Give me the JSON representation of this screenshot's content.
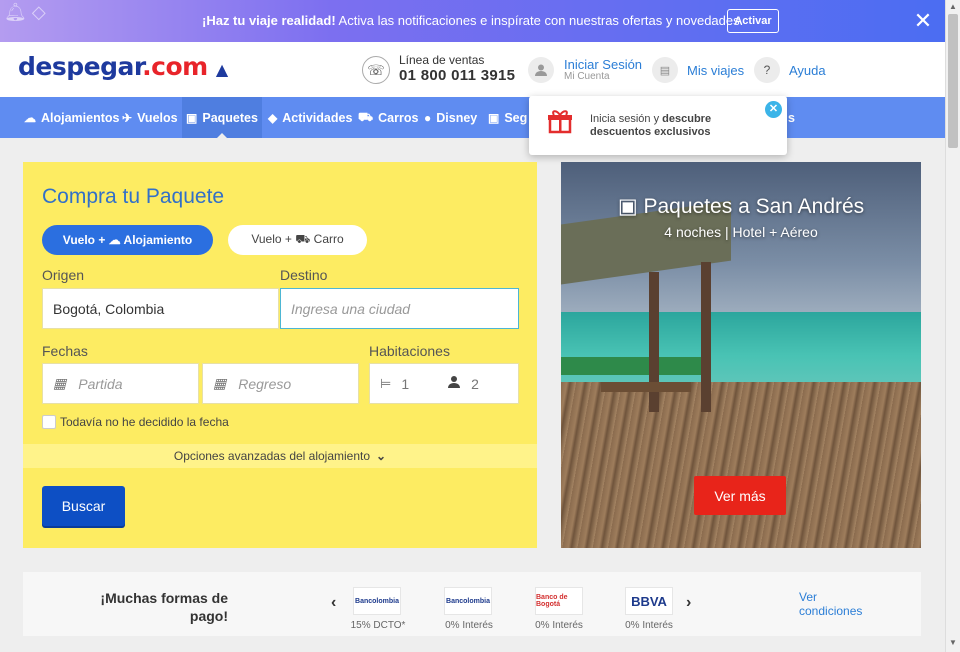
{
  "notification": {
    "bold": "¡Haz tu viaje realidad!",
    "text": " Activa las notificaciones e inspírate con nuestras ofertas y novedades.",
    "button": "Activar",
    "close": "✕"
  },
  "header": {
    "logo": "despegar",
    "logo_dot": ".com",
    "sales_label": "Línea de ventas",
    "sales_phone": "01 800 011 3915",
    "login": "Iniciar Sesión",
    "login_sub": "Mi Cuenta",
    "trips": "Mis viajes",
    "help": "Ayuda",
    "help_icon": "?"
  },
  "nav": {
    "items": [
      {
        "label": "Alojamientos",
        "icon": "☁"
      },
      {
        "label": "Vuelos",
        "icon": "✈"
      },
      {
        "label": "Paquetes",
        "icon": "▣"
      },
      {
        "label": "Actividades",
        "icon": "◆"
      },
      {
        "label": "Carros",
        "icon": "⛟"
      },
      {
        "label": "Disney",
        "icon": "●"
      },
      {
        "label": "Seg",
        "icon": "▣"
      },
      {
        "label": "s",
        "icon": ""
      }
    ]
  },
  "popup": {
    "text1": "Inicia sesión y ",
    "bold1": "descubre",
    "bold2": "descuentos exclusivos",
    "close": "✕"
  },
  "form": {
    "title": "Compra tu Paquete",
    "pill1": "Vuelo + ☁ Alojamiento",
    "pill2": "Vuelo + ⛟ Carro",
    "origin_label": "Origen",
    "origin_value": "Bogotá, Colombia",
    "dest_label": "Destino",
    "dest_placeholder": "Ingresa una ciudad",
    "dates_label": "Fechas",
    "start_placeholder": "Partida",
    "end_placeholder": "Regreso",
    "rooms_label": "Habitaciones",
    "rooms_value": "1",
    "people_value": "2",
    "undecided": "Todavía no he decidido la fecha",
    "advanced": "Opciones avanzadas del alojamiento",
    "search": "Buscar"
  },
  "promo": {
    "title": "Paquetes a San Andrés",
    "subtitle": "4 noches | Hotel + Aéreo",
    "button": "Ver más"
  },
  "payment": {
    "title": "¡Muchas formas de pago!",
    "banks": [
      {
        "name": "Bancolombia",
        "label": "15% DCTO*"
      },
      {
        "name": "Bancolombia",
        "label": "0% Interés"
      },
      {
        "name": "Banco de Bogotá",
        "label": "0% Interés"
      },
      {
        "name": "BBVA",
        "label": "0% Interés"
      }
    ],
    "conditions": "Ver condiciones"
  },
  "colors": {
    "brand": "#1e3a9e",
    "nav": "#5f8cf1",
    "form": "#fdec62",
    "cta": "#e8241a"
  }
}
